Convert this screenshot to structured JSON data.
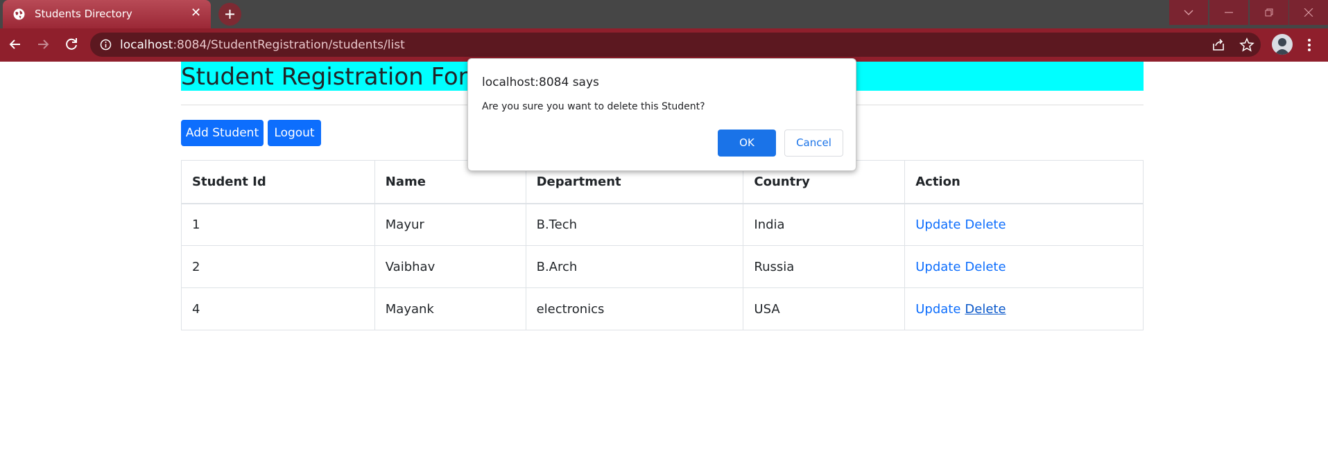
{
  "browser": {
    "tab_title": "Students Directory",
    "tab_close": "✕",
    "url_host": "localhost",
    "url_rest": ":8084/StudentRegistration/students/list",
    "accent_color": "#8f1f2c"
  },
  "page": {
    "heading": "Student Registration For D",
    "add_button": "Add Student",
    "logout_button": "Logout",
    "heading_bg": "#00ffff"
  },
  "table": {
    "headers": [
      "Student Id",
      "Name",
      "Department",
      "Country",
      "Action"
    ],
    "rows": [
      {
        "id": "1",
        "name": "Mayur",
        "department": "B.Tech",
        "country": "India",
        "update": "Update",
        "delete": "Delete"
      },
      {
        "id": "2",
        "name": "Vaibhav",
        "department": "B.Arch",
        "country": "Russia",
        "update": "Update",
        "delete": "Delete"
      },
      {
        "id": "4",
        "name": "Mayank",
        "department": "electronics",
        "country": "USA",
        "update": "Update",
        "delete": "Delete"
      }
    ]
  },
  "dialog": {
    "title": "localhost:8084 says",
    "message": "Are you sure you want to delete this Student?",
    "ok": "OK",
    "cancel": "Cancel"
  },
  "icons": [
    "globe-icon",
    "close-icon",
    "plus-icon",
    "back-icon",
    "forward-icon",
    "reload-icon",
    "info-icon",
    "share-icon",
    "star-icon",
    "menu-icon",
    "chevron-down-icon",
    "minimize-icon",
    "restore-icon",
    "window-close-icon"
  ]
}
